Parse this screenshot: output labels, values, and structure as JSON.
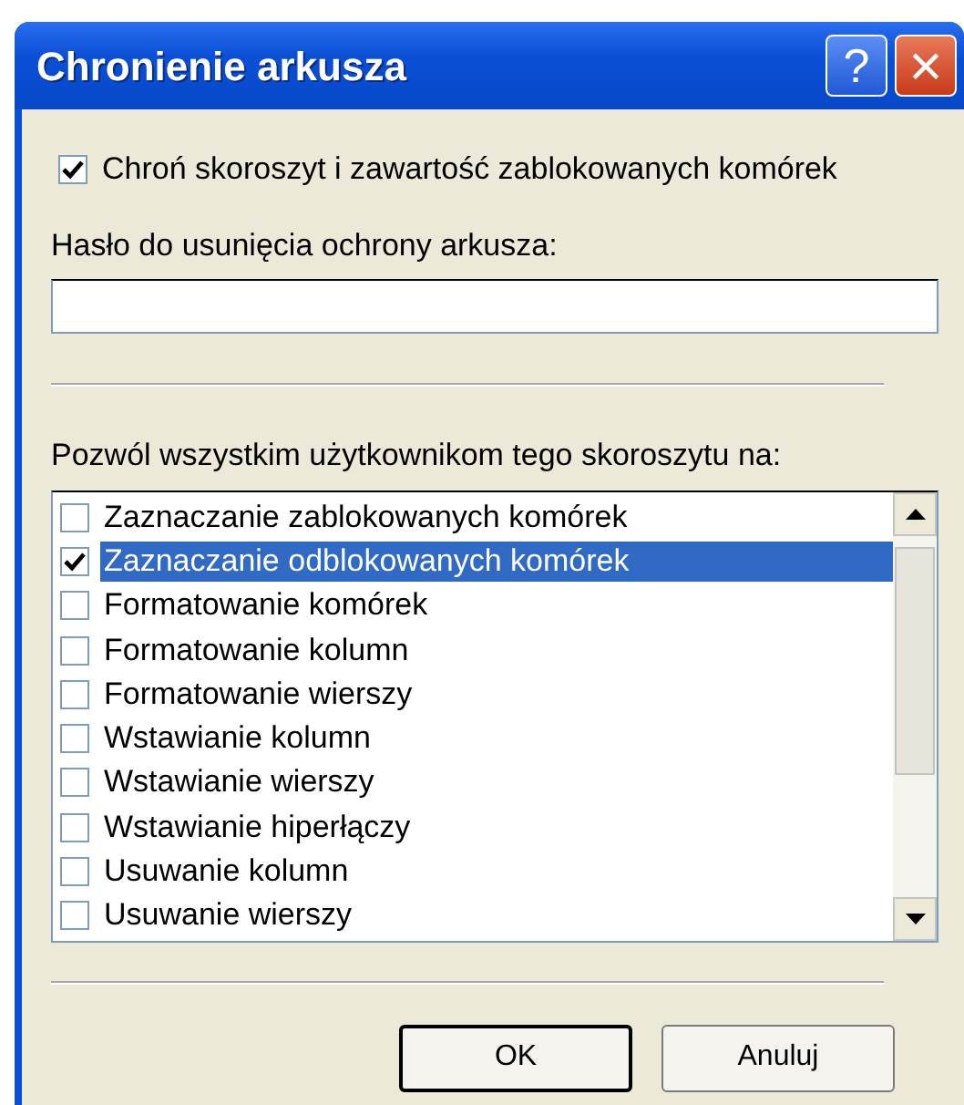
{
  "window": {
    "title": "Chronienie arkusza",
    "help_button": "?",
    "close_button": "×"
  },
  "protect": {
    "label": "Chroń skoroszyt i zawartość zablokowanych komórek",
    "checked": true
  },
  "password": {
    "label": "Hasło do usunięcia ochrony arkusza:"
  },
  "permissions": {
    "label": "Pozwól wszystkim użytkownikom tego skoroszytu na:",
    "items": [
      {
        "label": "Zaznaczanie zablokowanych komórek",
        "checked": false,
        "selected": false
      },
      {
        "label": "Zaznaczanie odblokowanych komórek",
        "checked": true,
        "selected": true
      },
      {
        "label": "Formatowanie komórek",
        "checked": false,
        "selected": false
      },
      {
        "label": "Formatowanie kolumn",
        "checked": false,
        "selected": false
      },
      {
        "label": "Formatowanie wierszy",
        "checked": false,
        "selected": false
      },
      {
        "label": "Wstawianie kolumn",
        "checked": false,
        "selected": false
      },
      {
        "label": "Wstawianie wierszy",
        "checked": false,
        "selected": false
      },
      {
        "label": "Wstawianie hiperłączy",
        "checked": false,
        "selected": false
      },
      {
        "label": "Usuwanie kolumn",
        "checked": false,
        "selected": false
      },
      {
        "label": "Usuwanie wierszy",
        "checked": false,
        "selected": false
      }
    ]
  },
  "buttons": [
    {
      "label": "OK",
      "default": true
    },
    {
      "label": "Anuluj",
      "default": false
    }
  ]
}
